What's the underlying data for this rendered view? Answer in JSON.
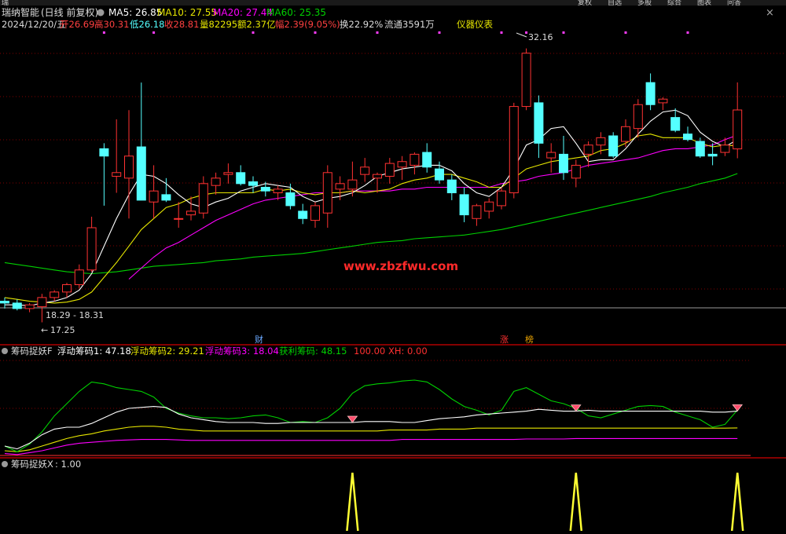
{
  "top_strip": {
    "left_clip": "瑞",
    "right_items": [
      "复权",
      "自选",
      "多股",
      "综合",
      "图表",
      "问答"
    ],
    "close_icon": "close-icon"
  },
  "header": {
    "stock_name": "瑞纳智能",
    "mode": "(日线 前复权)",
    "ma": [
      {
        "label": "MA5: 26.85",
        "color": "#ffffff"
      },
      {
        "label": "MA10: 27.55",
        "color": "#e6e600"
      },
      {
        "label": "MA20: 27.44",
        "color": "#ff00ff"
      },
      {
        "label": "MA60: 25.35",
        "color": "#00d000"
      }
    ],
    "date": "2024/12/20/五",
    "open": "开26.69",
    "high": "高30.31",
    "low": "低26.18",
    "close": "收28.81",
    "volume": "量82295",
    "amount": "额2.37亿",
    "change": "幅2.39(9.05%)",
    "turnover": "换22.92%",
    "float_shares": "流通3591万",
    "industry": "仪器仪表"
  },
  "annotations": {
    "high_price": "32.16",
    "low_price": "17.25",
    "range": "18.29 - 18.31",
    "watermark": "www.zbzfwu.com",
    "tag_cai": "财",
    "tag_zhang": "涨",
    "tag_bang": "榜"
  },
  "chips_panel": {
    "title": "筹码捉妖F",
    "items": [
      {
        "label": "浮动筹码1: 47.18",
        "color": "#ffffff"
      },
      {
        "label": "浮动筹码2: 29.21",
        "color": "#e6e600"
      },
      {
        "label": "浮动筹码3: 18.04",
        "color": "#ff00ff"
      },
      {
        "label": "获利筹码: 48.15",
        "color": "#00d000"
      },
      {
        "label": "100.00",
        "color": "#ff3030"
      },
      {
        "label": "XH: 0.00",
        "color": "#ff3030"
      }
    ]
  },
  "signal_panel": {
    "title": "筹码捉妖X",
    "value": ": 1.00"
  },
  "colors": {
    "up": "#ff3232",
    "down": "#54ffff",
    "ma5": "#ffffff",
    "ma10": "#e6e600",
    "ma20": "#ff00ff",
    "ma60": "#00d000",
    "grid": "#7f0000",
    "signal": "#ffff33"
  },
  "chart_data": {
    "type": "candlestick",
    "price_axis_range": [
      16.5,
      33.0
    ],
    "candles": [
      {
        "o": 18.4,
        "h": 18.6,
        "l": 18.0,
        "c": 18.3
      },
      {
        "o": 18.3,
        "h": 18.5,
        "l": 17.9,
        "c": 18.0
      },
      {
        "o": 18.0,
        "h": 18.3,
        "l": 17.8,
        "c": 18.2
      },
      {
        "o": 18.1,
        "h": 18.8,
        "l": 17.25,
        "c": 18.6
      },
      {
        "o": 18.6,
        "h": 19.0,
        "l": 18.4,
        "c": 18.9
      },
      {
        "o": 18.9,
        "h": 19.4,
        "l": 18.6,
        "c": 19.3
      },
      {
        "o": 19.3,
        "h": 20.4,
        "l": 19.1,
        "c": 20.1
      },
      {
        "o": 20.1,
        "h": 23.0,
        "l": 20.0,
        "c": 22.4
      },
      {
        "o": 26.7,
        "h": 27.0,
        "l": 23.6,
        "c": 26.3
      },
      {
        "o": 25.2,
        "h": 28.3,
        "l": 24.3,
        "c": 25.4
      },
      {
        "o": 25.1,
        "h": 28.8,
        "l": 22.9,
        "c": 26.3
      },
      {
        "o": 26.8,
        "h": 30.3,
        "l": 24.1,
        "c": 23.9
      },
      {
        "o": 23.8,
        "h": 25.8,
        "l": 22.9,
        "c": 24.4
      },
      {
        "o": 24.2,
        "h": 25.1,
        "l": 23.8,
        "c": 23.9
      },
      {
        "o": 22.9,
        "h": 23.8,
        "l": 22.4,
        "c": 22.9
      },
      {
        "o": 23.1,
        "h": 24.1,
        "l": 22.8,
        "c": 23.3
      },
      {
        "o": 23.2,
        "h": 25.2,
        "l": 22.9,
        "c": 24.8
      },
      {
        "o": 24.7,
        "h": 25.4,
        "l": 24.2,
        "c": 25.1
      },
      {
        "o": 25.3,
        "h": 25.9,
        "l": 24.8,
        "c": 25.4
      },
      {
        "o": 25.4,
        "h": 25.8,
        "l": 24.7,
        "c": 24.8
      },
      {
        "o": 24.9,
        "h": 25.2,
        "l": 24.3,
        "c": 24.7
      },
      {
        "o": 24.6,
        "h": 24.9,
        "l": 24.1,
        "c": 24.4
      },
      {
        "o": 24.3,
        "h": 24.7,
        "l": 23.9,
        "c": 24.5
      },
      {
        "o": 24.3,
        "h": 24.8,
        "l": 23.4,
        "c": 23.6
      },
      {
        "o": 23.3,
        "h": 23.7,
        "l": 22.6,
        "c": 22.9
      },
      {
        "o": 22.8,
        "h": 23.8,
        "l": 22.4,
        "c": 23.6
      },
      {
        "o": 23.2,
        "h": 25.8,
        "l": 22.4,
        "c": 25.4
      },
      {
        "o": 24.5,
        "h": 25.2,
        "l": 23.9,
        "c": 24.8
      },
      {
        "o": 24.5,
        "h": 26.0,
        "l": 24.1,
        "c": 25.0
      },
      {
        "o": 25.3,
        "h": 26.2,
        "l": 24.9,
        "c": 25.7
      },
      {
        "o": 25.1,
        "h": 25.4,
        "l": 24.3,
        "c": 25.3
      },
      {
        "o": 25.2,
        "h": 26.2,
        "l": 24.8,
        "c": 25.9
      },
      {
        "o": 25.7,
        "h": 26.3,
        "l": 25.0,
        "c": 26.0
      },
      {
        "o": 25.8,
        "h": 26.5,
        "l": 25.3,
        "c": 26.4
      },
      {
        "o": 26.5,
        "h": 27.0,
        "l": 25.4,
        "c": 25.7
      },
      {
        "o": 25.6,
        "h": 26.0,
        "l": 24.8,
        "c": 25.0
      },
      {
        "o": 25.0,
        "h": 25.3,
        "l": 23.9,
        "c": 24.3
      },
      {
        "o": 24.2,
        "h": 24.6,
        "l": 22.7,
        "c": 23.1
      },
      {
        "o": 22.9,
        "h": 23.7,
        "l": 22.5,
        "c": 23.6
      },
      {
        "o": 23.3,
        "h": 24.0,
        "l": 22.9,
        "c": 23.8
      },
      {
        "o": 23.6,
        "h": 24.6,
        "l": 23.4,
        "c": 24.4
      },
      {
        "o": 24.3,
        "h": 29.2,
        "l": 24.0,
        "c": 29.0
      },
      {
        "o": 29.0,
        "h": 32.16,
        "l": 28.8,
        "c": 31.9
      },
      {
        "o": 29.2,
        "h": 29.6,
        "l": 26.2,
        "c": 27.0
      },
      {
        "o": 26.2,
        "h": 27.0,
        "l": 25.4,
        "c": 26.5
      },
      {
        "o": 26.4,
        "h": 27.4,
        "l": 25.0,
        "c": 25.4
      },
      {
        "o": 25.1,
        "h": 26.1,
        "l": 24.6,
        "c": 25.8
      },
      {
        "o": 26.4,
        "h": 27.1,
        "l": 25.7,
        "c": 26.9
      },
      {
        "o": 26.9,
        "h": 27.6,
        "l": 26.4,
        "c": 27.3
      },
      {
        "o": 27.4,
        "h": 27.6,
        "l": 26.2,
        "c": 26.3
      },
      {
        "o": 27.1,
        "h": 28.3,
        "l": 26.8,
        "c": 27.9
      },
      {
        "o": 27.8,
        "h": 29.4,
        "l": 27.3,
        "c": 29.1
      },
      {
        "o": 30.3,
        "h": 30.8,
        "l": 28.8,
        "c": 29.1
      },
      {
        "o": 29.2,
        "h": 29.5,
        "l": 28.8,
        "c": 29.4
      },
      {
        "o": 28.4,
        "h": 28.9,
        "l": 27.6,
        "c": 27.7
      },
      {
        "o": 27.5,
        "h": 27.9,
        "l": 27.1,
        "c": 27.2
      },
      {
        "o": 27.1,
        "h": 27.3,
        "l": 26.2,
        "c": 26.3
      },
      {
        "o": 26.4,
        "h": 27.0,
        "l": 25.8,
        "c": 26.3
      },
      {
        "o": 26.5,
        "h": 27.3,
        "l": 26.3,
        "c": 26.9
      },
      {
        "o": 26.69,
        "h": 30.31,
        "l": 26.18,
        "c": 28.81
      }
    ],
    "ma5": [
      18.2,
      18.2,
      18.15,
      18.3,
      18.4,
      18.6,
      19.0,
      19.9,
      21.4,
      22.9,
      24.2,
      25.3,
      25.2,
      24.8,
      24.2,
      23.7,
      23.5,
      23.8,
      24.0,
      24.4,
      24.6,
      24.8,
      24.7,
      24.6,
      24.1,
      23.8,
      24.0,
      24.1,
      24.3,
      24.7,
      25.2,
      25.4,
      25.6,
      25.7,
      25.8,
      25.8,
      25.5,
      24.8,
      24.3,
      24.1,
      24.6,
      25.6,
      26.9,
      27.2,
      27.8,
      27.9,
      27.0,
      26.0,
      26.1,
      26.1,
      26.7,
      27.5,
      28.2,
      28.7,
      28.8,
      28.5,
      27.6,
      27.1,
      26.8,
      27.2
    ],
    "ma10": [
      18.6,
      18.5,
      18.4,
      18.35,
      18.3,
      18.35,
      18.5,
      18.9,
      19.7,
      20.5,
      21.4,
      22.3,
      22.9,
      23.5,
      23.7,
      24.0,
      24.2,
      24.3,
      24.3,
      24.3,
      24.3,
      24.5,
      24.4,
      24.5,
      24.3,
      24.2,
      24.3,
      24.3,
      24.4,
      24.3,
      24.4,
      24.5,
      24.8,
      25.0,
      25.1,
      25.3,
      25.3,
      25.1,
      24.9,
      24.6,
      24.6,
      25.1,
      25.6,
      25.8,
      26.0,
      26.1,
      26.2,
      26.3,
      26.6,
      26.7,
      27.0,
      27.4,
      27.5,
      27.3,
      27.3,
      27.3,
      27.0,
      26.8,
      26.9,
      26.85
    ],
    "ma20": [
      null,
      null,
      null,
      null,
      null,
      null,
      null,
      null,
      null,
      null,
      19.6,
      20.2,
      20.8,
      21.3,
      21.6,
      22.0,
      22.4,
      22.8,
      23.1,
      23.4,
      23.7,
      23.9,
      24.0,
      24.1,
      24.2,
      24.3,
      24.3,
      24.3,
      24.4,
      24.4,
      24.4,
      24.4,
      24.5,
      24.5,
      24.6,
      24.6,
      24.6,
      24.6,
      24.6,
      24.6,
      24.8,
      24.9,
      25.0,
      25.2,
      25.3,
      25.4,
      25.6,
      25.8,
      25.9,
      26.0,
      26.1,
      26.2,
      26.4,
      26.6,
      26.7,
      26.7,
      26.8,
      26.9,
      27.2,
      27.44
    ],
    "ma60": [
      20.5,
      20.4,
      20.3,
      20.2,
      20.1,
      20.0,
      19.95,
      19.9,
      19.95,
      20.0,
      20.1,
      20.2,
      20.3,
      20.35,
      20.4,
      20.45,
      20.5,
      20.6,
      20.65,
      20.7,
      20.8,
      20.85,
      20.9,
      20.95,
      21.0,
      21.1,
      21.2,
      21.3,
      21.4,
      21.5,
      21.6,
      21.65,
      21.7,
      21.8,
      21.85,
      21.9,
      21.95,
      22.0,
      22.1,
      22.2,
      22.3,
      22.45,
      22.6,
      22.75,
      22.9,
      23.05,
      23.2,
      23.35,
      23.5,
      23.65,
      23.8,
      23.95,
      24.1,
      24.3,
      24.45,
      24.6,
      24.8,
      24.95,
      25.1,
      25.35
    ],
    "chips_range": [
      0,
      100
    ],
    "float1": [
      10,
      7,
      13,
      22,
      28,
      30,
      30,
      34,
      40,
      46,
      50,
      51,
      52,
      51,
      44,
      40,
      38,
      36,
      35,
      35,
      35,
      34,
      34,
      35,
      35,
      35,
      35,
      35,
      35,
      36,
      36,
      36,
      35,
      35,
      37,
      39,
      40,
      41,
      43,
      44,
      45,
      46,
      47,
      49,
      48,
      47,
      47,
      48,
      47,
      47,
      47,
      47,
      47,
      47,
      47,
      47,
      47,
      46,
      46,
      47.18
    ],
    "float2": [
      5,
      4,
      6,
      10,
      14,
      18,
      21,
      23,
      26,
      28,
      30,
      31,
      31,
      30,
      28,
      27,
      26,
      26,
      26,
      26,
      26,
      26,
      26,
      26,
      26,
      26,
      26,
      26,
      26,
      26,
      26,
      27,
      27,
      27,
      27,
      28,
      28,
      28,
      29,
      29,
      29,
      29,
      29,
      29,
      29,
      29,
      29,
      29,
      29,
      29,
      29,
      29,
      29,
      29,
      29,
      29,
      29,
      29,
      29,
      29.21
    ],
    "float3": [
      2,
      1,
      3,
      5,
      8,
      11,
      13,
      14,
      15,
      16,
      16.5,
      17,
      17,
      17,
      16.5,
      16,
      16,
      16,
      16,
      16,
      16,
      16,
      16,
      16,
      16,
      16,
      16,
      16,
      16,
      16,
      16,
      16,
      17,
      17,
      17,
      17,
      17,
      17,
      17,
      17,
      17,
      17,
      17.5,
      17.5,
      17.5,
      17.5,
      18,
      18,
      18,
      18,
      18,
      18,
      18,
      18,
      18,
      18,
      18,
      18,
      18,
      18.04
    ],
    "profit": [
      10,
      4,
      12,
      25,
      42,
      55,
      68,
      78,
      76,
      72,
      70,
      68,
      62,
      50,
      45,
      42,
      40,
      40,
      39,
      40,
      42,
      43,
      40,
      35,
      36,
      35,
      40,
      50,
      66,
      74,
      76,
      77,
      79,
      80,
      78,
      70,
      60,
      52,
      48,
      43,
      48,
      68,
      72,
      65,
      58,
      55,
      50,
      42,
      40,
      44,
      48,
      52,
      53,
      52,
      46,
      42,
      38,
      30,
      33,
      48.15
    ],
    "xh_markers": [
      28,
      46,
      59
    ],
    "signal_x": [
      28,
      46,
      59
    ],
    "signal_value": 1.0
  }
}
